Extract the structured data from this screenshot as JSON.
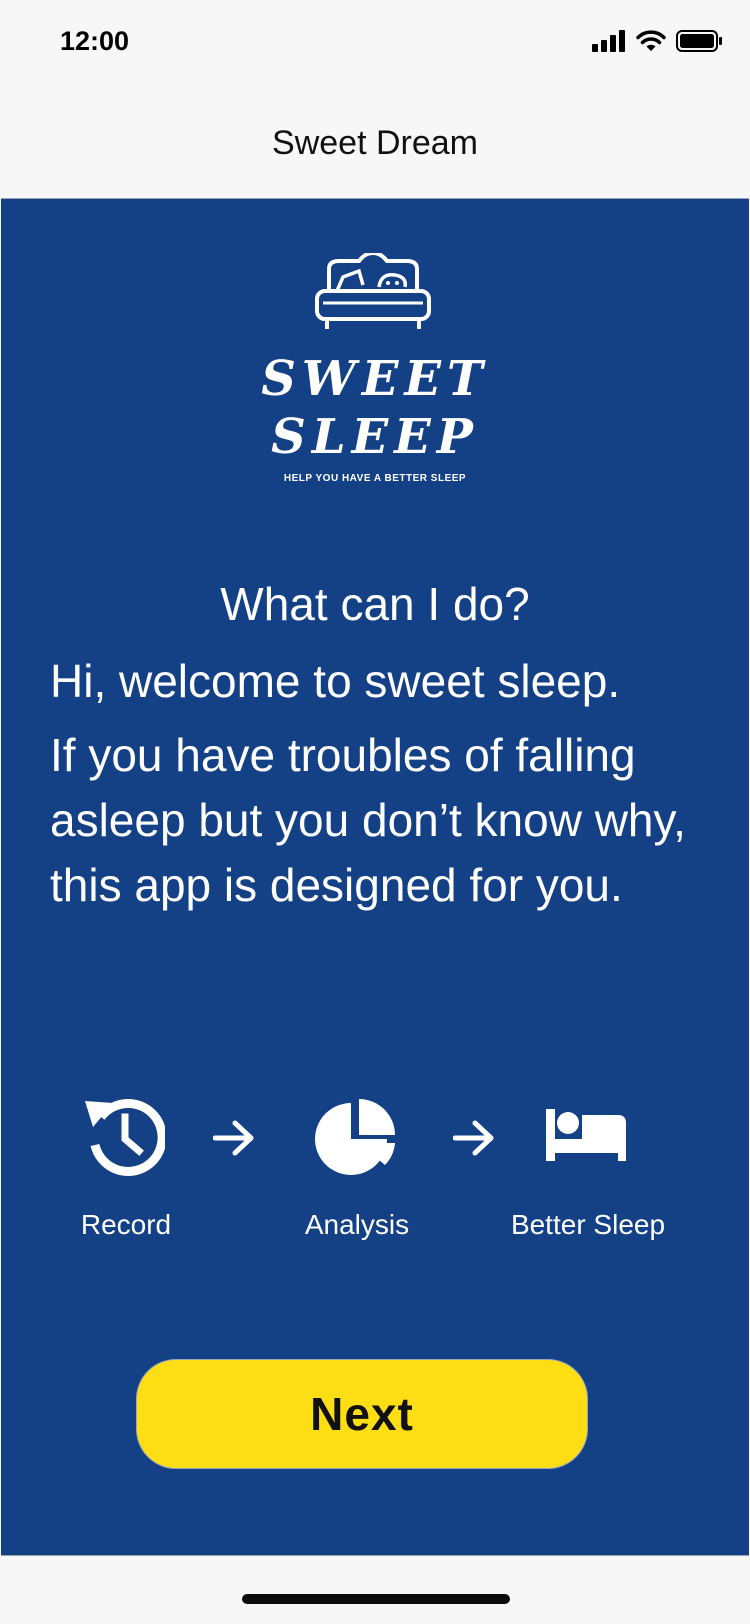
{
  "status_bar": {
    "time": "12:00"
  },
  "nav": {
    "title": "Sweet Dream"
  },
  "logo": {
    "line1": "SWEET",
    "line2": "SLEEP",
    "tagline": "HELP YOU HAVE A BETTER SLEEP"
  },
  "heading": "What can I do?",
  "intro": {
    "welcome": "Hi, welcome to sweet sleep.",
    "body": "If you have troubles of falling asleep but you don’t know why, this app is designed for you."
  },
  "steps": [
    {
      "icon": "history-icon",
      "label": "Record"
    },
    {
      "icon": "pie-chart-icon",
      "label": "Analysis"
    },
    {
      "icon": "bed-icon",
      "label": "Better Sleep"
    }
  ],
  "next_button": {
    "label": "Next"
  },
  "colors": {
    "background": "#144186",
    "button": "#fddd14",
    "text": "#ffffff"
  }
}
